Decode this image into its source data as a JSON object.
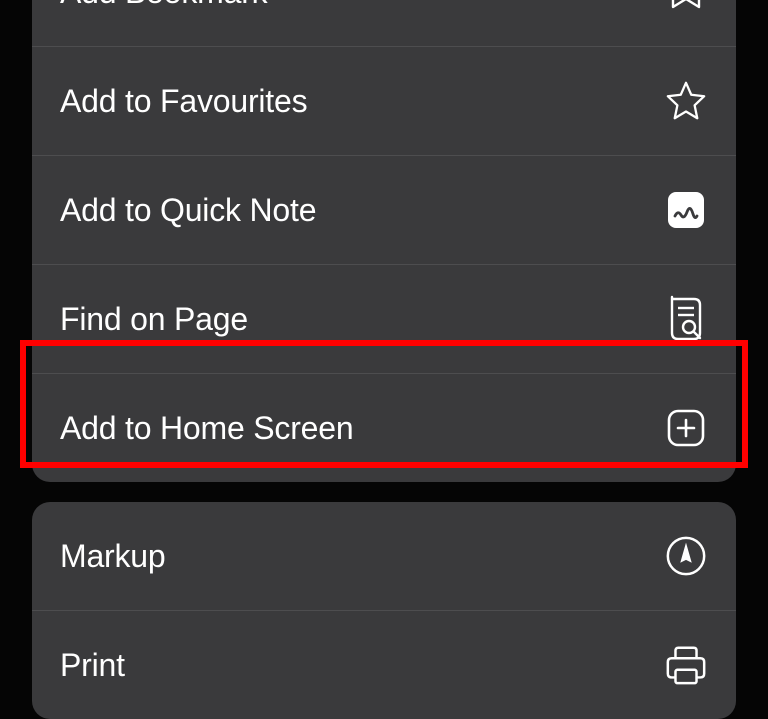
{
  "menu": {
    "group1": [
      {
        "label": "Add Bookmark",
        "icon": "bookmark-icon"
      },
      {
        "label": "Add to Favourites",
        "icon": "star-icon"
      },
      {
        "label": "Add to Quick Note",
        "icon": "quick-note-icon"
      },
      {
        "label": "Find on Page",
        "icon": "find-on-page-icon"
      },
      {
        "label": "Add to Home Screen",
        "icon": "add-home-icon",
        "highlighted": true
      }
    ],
    "group2": [
      {
        "label": "Markup",
        "icon": "markup-icon"
      },
      {
        "label": "Print",
        "icon": "print-icon"
      }
    ]
  }
}
